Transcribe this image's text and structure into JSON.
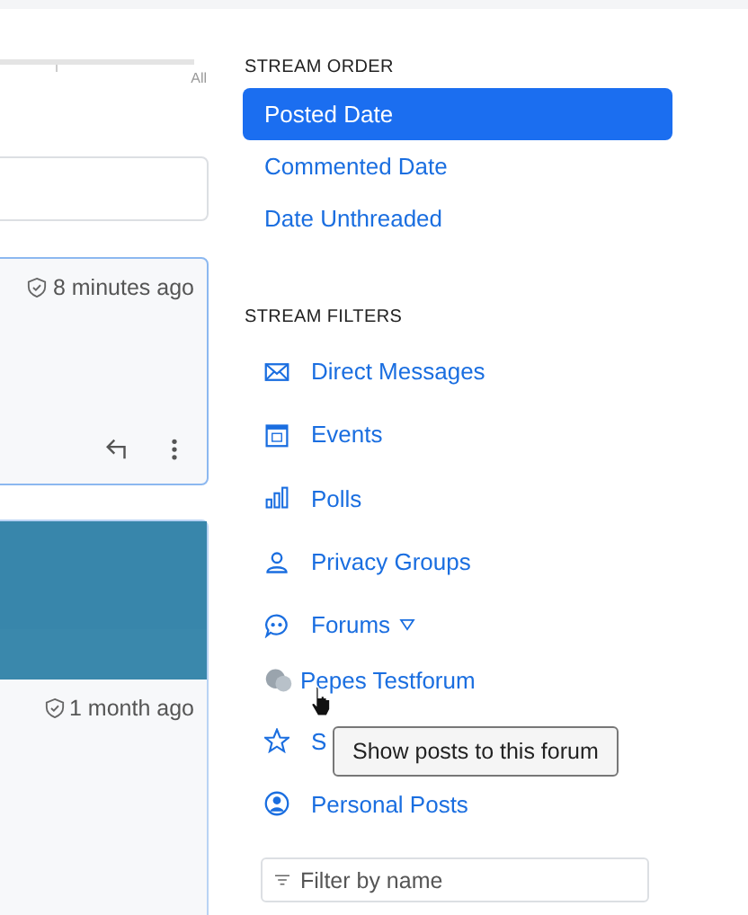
{
  "slider": {
    "end_label": "All"
  },
  "posts": [
    {
      "time": "8 minutes ago",
      "has_image": false
    },
    {
      "time": "1 month ago",
      "has_image": true
    }
  ],
  "stream_order": {
    "heading": "STREAM ORDER",
    "items": [
      {
        "label": "Posted Date",
        "selected": true
      },
      {
        "label": "Commented Date",
        "selected": false
      },
      {
        "label": "Date Unthreaded",
        "selected": false
      }
    ]
  },
  "stream_filters": {
    "heading": "STREAM FILTERS",
    "items": [
      {
        "label": "Direct Messages"
      },
      {
        "label": "Events"
      },
      {
        "label": "Polls"
      },
      {
        "label": "Privacy Groups"
      },
      {
        "label": "Forums",
        "expanded": true,
        "children": [
          {
            "label": "Pepes Testforum"
          }
        ]
      },
      {
        "label": "S"
      },
      {
        "label": "Personal Posts"
      }
    ],
    "filter": {
      "placeholder": "Filter by name"
    }
  },
  "tooltip": "Show posts to this forum"
}
